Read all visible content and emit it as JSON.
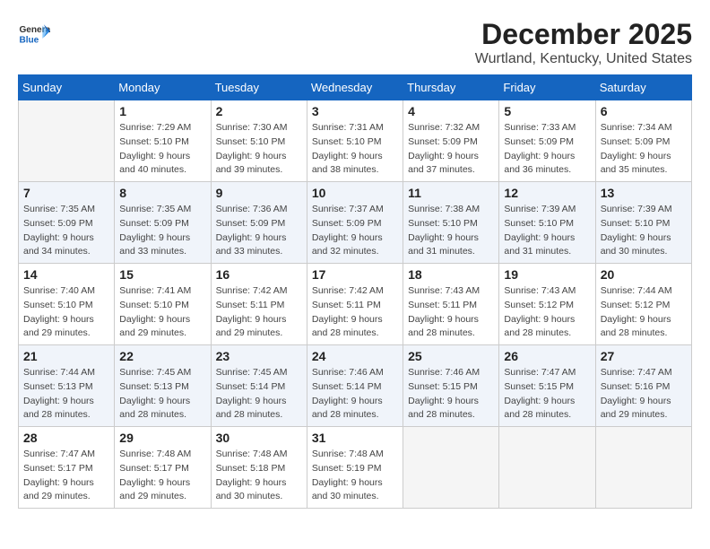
{
  "header": {
    "logo_line1": "General",
    "logo_line2": "Blue",
    "month": "December 2025",
    "location": "Wurtland, Kentucky, United States"
  },
  "days_of_week": [
    "Sunday",
    "Monday",
    "Tuesday",
    "Wednesday",
    "Thursday",
    "Friday",
    "Saturday"
  ],
  "weeks": [
    [
      {
        "day": "",
        "empty": true
      },
      {
        "day": "1",
        "sunrise": "7:29 AM",
        "sunset": "5:10 PM",
        "daylight": "9 hours and 40 minutes."
      },
      {
        "day": "2",
        "sunrise": "7:30 AM",
        "sunset": "5:10 PM",
        "daylight": "9 hours and 39 minutes."
      },
      {
        "day": "3",
        "sunrise": "7:31 AM",
        "sunset": "5:10 PM",
        "daylight": "9 hours and 38 minutes."
      },
      {
        "day": "4",
        "sunrise": "7:32 AM",
        "sunset": "5:09 PM",
        "daylight": "9 hours and 37 minutes."
      },
      {
        "day": "5",
        "sunrise": "7:33 AM",
        "sunset": "5:09 PM",
        "daylight": "9 hours and 36 minutes."
      },
      {
        "day": "6",
        "sunrise": "7:34 AM",
        "sunset": "5:09 PM",
        "daylight": "9 hours and 35 minutes."
      }
    ],
    [
      {
        "day": "7",
        "sunrise": "7:35 AM",
        "sunset": "5:09 PM",
        "daylight": "9 hours and 34 minutes."
      },
      {
        "day": "8",
        "sunrise": "7:35 AM",
        "sunset": "5:09 PM",
        "daylight": "9 hours and 33 minutes."
      },
      {
        "day": "9",
        "sunrise": "7:36 AM",
        "sunset": "5:09 PM",
        "daylight": "9 hours and 33 minutes."
      },
      {
        "day": "10",
        "sunrise": "7:37 AM",
        "sunset": "5:09 PM",
        "daylight": "9 hours and 32 minutes."
      },
      {
        "day": "11",
        "sunrise": "7:38 AM",
        "sunset": "5:10 PM",
        "daylight": "9 hours and 31 minutes."
      },
      {
        "day": "12",
        "sunrise": "7:39 AM",
        "sunset": "5:10 PM",
        "daylight": "9 hours and 31 minutes."
      },
      {
        "day": "13",
        "sunrise": "7:39 AM",
        "sunset": "5:10 PM",
        "daylight": "9 hours and 30 minutes."
      }
    ],
    [
      {
        "day": "14",
        "sunrise": "7:40 AM",
        "sunset": "5:10 PM",
        "daylight": "9 hours and 29 minutes."
      },
      {
        "day": "15",
        "sunrise": "7:41 AM",
        "sunset": "5:10 PM",
        "daylight": "9 hours and 29 minutes."
      },
      {
        "day": "16",
        "sunrise": "7:42 AM",
        "sunset": "5:11 PM",
        "daylight": "9 hours and 29 minutes."
      },
      {
        "day": "17",
        "sunrise": "7:42 AM",
        "sunset": "5:11 PM",
        "daylight": "9 hours and 28 minutes."
      },
      {
        "day": "18",
        "sunrise": "7:43 AM",
        "sunset": "5:11 PM",
        "daylight": "9 hours and 28 minutes."
      },
      {
        "day": "19",
        "sunrise": "7:43 AM",
        "sunset": "5:12 PM",
        "daylight": "9 hours and 28 minutes."
      },
      {
        "day": "20",
        "sunrise": "7:44 AM",
        "sunset": "5:12 PM",
        "daylight": "9 hours and 28 minutes."
      }
    ],
    [
      {
        "day": "21",
        "sunrise": "7:44 AM",
        "sunset": "5:13 PM",
        "daylight": "9 hours and 28 minutes."
      },
      {
        "day": "22",
        "sunrise": "7:45 AM",
        "sunset": "5:13 PM",
        "daylight": "9 hours and 28 minutes."
      },
      {
        "day": "23",
        "sunrise": "7:45 AM",
        "sunset": "5:14 PM",
        "daylight": "9 hours and 28 minutes."
      },
      {
        "day": "24",
        "sunrise": "7:46 AM",
        "sunset": "5:14 PM",
        "daylight": "9 hours and 28 minutes."
      },
      {
        "day": "25",
        "sunrise": "7:46 AM",
        "sunset": "5:15 PM",
        "daylight": "9 hours and 28 minutes."
      },
      {
        "day": "26",
        "sunrise": "7:47 AM",
        "sunset": "5:15 PM",
        "daylight": "9 hours and 28 minutes."
      },
      {
        "day": "27",
        "sunrise": "7:47 AM",
        "sunset": "5:16 PM",
        "daylight": "9 hours and 29 minutes."
      }
    ],
    [
      {
        "day": "28",
        "sunrise": "7:47 AM",
        "sunset": "5:17 PM",
        "daylight": "9 hours and 29 minutes."
      },
      {
        "day": "29",
        "sunrise": "7:48 AM",
        "sunset": "5:17 PM",
        "daylight": "9 hours and 29 minutes."
      },
      {
        "day": "30",
        "sunrise": "7:48 AM",
        "sunset": "5:18 PM",
        "daylight": "9 hours and 30 minutes."
      },
      {
        "day": "31",
        "sunrise": "7:48 AM",
        "sunset": "5:19 PM",
        "daylight": "9 hours and 30 minutes."
      },
      {
        "day": "",
        "empty": true
      },
      {
        "day": "",
        "empty": true
      },
      {
        "day": "",
        "empty": true
      }
    ]
  ],
  "labels": {
    "sunrise_prefix": "Sunrise: ",
    "sunset_prefix": "Sunset: ",
    "daylight_prefix": "Daylight: "
  }
}
